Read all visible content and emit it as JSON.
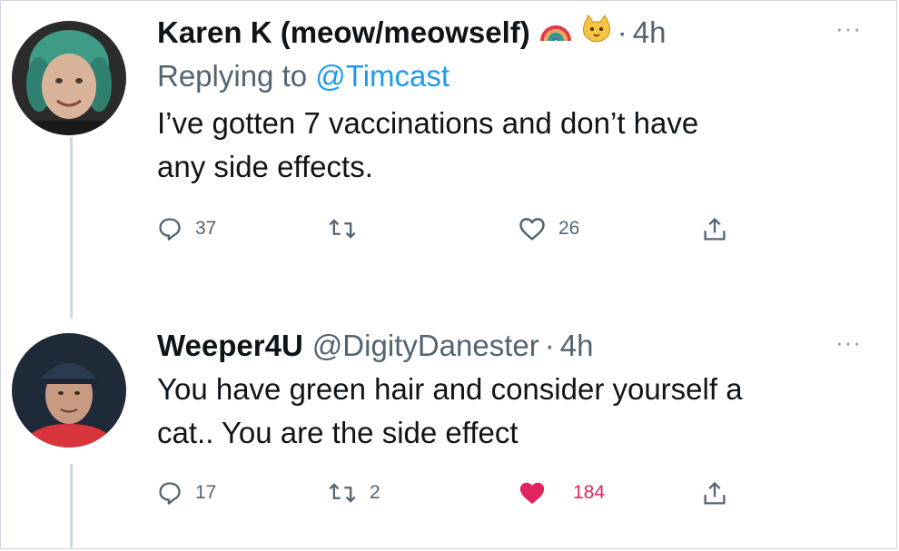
{
  "tweets": [
    {
      "display_name": "Karen K (meow/meowself)",
      "emojis": [
        "rainbow-emoji",
        "cat-face-emoji"
      ],
      "time": "4h",
      "replying_prefix": "Replying to",
      "replying_handle": "@Timcast",
      "text_line1": "I’ve gotten 7 vaccinations and don’t have",
      "text_line2": "any side effects.",
      "reply_count": "37",
      "retweet_count": "",
      "like_count": "26",
      "liked": false
    },
    {
      "display_name": "Weeper4U",
      "handle": "@DigityDanester",
      "time": "4h",
      "text_line1": "You have green hair and consider yourself a",
      "text_line2": "cat.. You are the side effect",
      "reply_count": "17",
      "retweet_count": "2",
      "like_count": "184",
      "liked": true
    }
  ],
  "separator_dot": "·",
  "more_label": "···",
  "colors": {
    "text": "#0f1419",
    "secondary": "#536471",
    "link": "#1d9bf0",
    "like_active": "#e0245e",
    "thread_line": "#cfd9de"
  }
}
